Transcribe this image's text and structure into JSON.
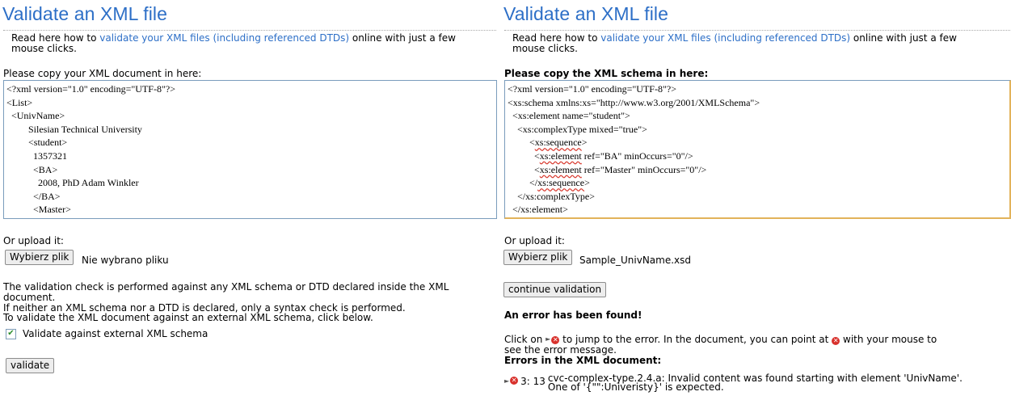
{
  "left": {
    "title": "Validate an XML file",
    "intro_prefix": "Read here how to ",
    "intro_link": "validate your XML files (including referenced DTDs)",
    "intro_suffix_line1": " online with just a few",
    "intro_suffix_line2": "mouse clicks.",
    "doc_label": "Please copy your XML document in here:",
    "doc_lines": [
      "<?xml version=\"1.0\" encoding=\"UTF-8\"?>",
      "<List>",
      "  <UnivName>",
      "         Silesian Technical University",
      "         <student>",
      "           1357321",
      "           <BA>",
      "             2008, PhD Adam Winkler",
      "           </BA>",
      "           <Master>"
    ],
    "upload_label": "Or upload it:",
    "upload_button": "Wybierz plik",
    "upload_filename": "Nie wybrano pliku",
    "note_line1": "The validation check is performed against any XML schema or DTD declared inside the XML",
    "note_line2": "document.",
    "note_line3": "If neither an XML schema nor a DTD is declared, only a syntax check is performed.",
    "note_line4": "To validate the XML document against an external XML schema, click below.",
    "checkbox_label": "Validate against external XML schema",
    "checkbox_checked": true,
    "validate_button": "validate"
  },
  "right": {
    "title": "Validate an XML file",
    "intro_prefix": "Read here how to ",
    "intro_link": "validate your XML files (including referenced DTDs)",
    "intro_suffix_line1": " online with just a few",
    "intro_suffix_line2": "mouse clicks.",
    "schema_label": "Please copy the XML schema in here:",
    "schema_lines": [
      "<?xml version=\"1.0\" encoding=\"UTF-8\"?>",
      "<xs:schema xmlns:xs=\"http://www.w3.org/2001/XMLSchema\">",
      "  <xs:element name=\"student\">",
      "    <xs:complexType mixed=\"true\">",
      "         <xs:sequence>",
      "           <xs:element ref=\"BA\" minOccurs=\"0\"/>",
      "           <xs:element ref=\"Master\" minOccurs=\"0\"/>",
      "         </xs:sequence>",
      "    </xs:complexType>",
      "  </xs:element>"
    ],
    "upload_label": "Or upload it:",
    "upload_button": "Wybierz plik",
    "upload_filename": "Sample_UnivName.xsd",
    "continue_button": "continue validation",
    "error_found": "An error has been found!",
    "click_line_a": "Click on ",
    "click_line_b": " to jump to the error. In the document, you can point at ",
    "click_line_c": " with your mouse to",
    "click_line2": "see the error message.",
    "errors_heading": "Errors in the XML document:",
    "error_position": "3: 13",
    "error_msg_line1": "cvc-complex-type.2.4.a: Invalid content was found starting with element 'UnivName'.",
    "error_msg_line2": "One of '{\"\":Univeristy}' is expected."
  },
  "colors": {
    "title": "#2d6fc7",
    "link": "#2d6fc7",
    "error_icon": "#d8312c",
    "schema_focus_border": "#e2b35a"
  },
  "icons": {
    "error": "error-x-icon",
    "jump": "jump-arrow-icon",
    "check": "checkmark-icon"
  }
}
